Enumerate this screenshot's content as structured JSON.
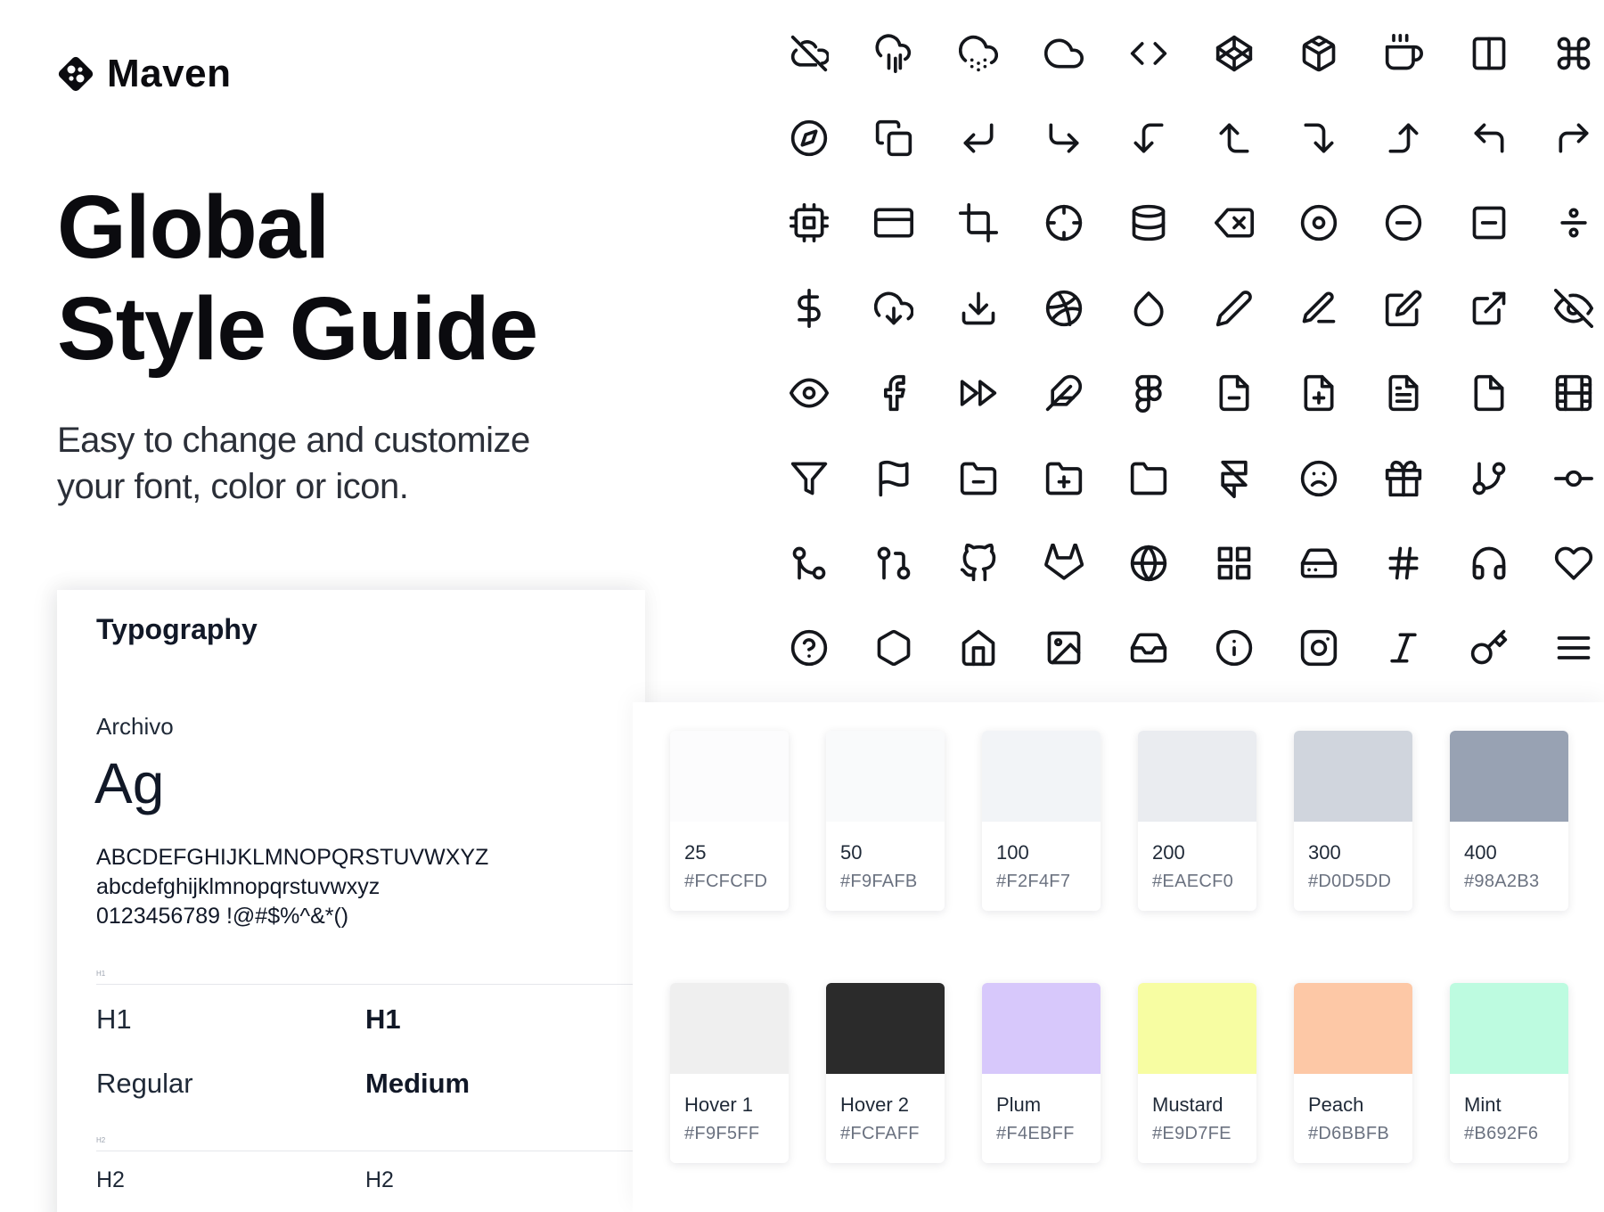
{
  "brand": {
    "name": "Maven",
    "logo_icon": "maven-logo-icon"
  },
  "hero": {
    "title_line1": "Global",
    "title_line2": "Style Guide",
    "subtitle_line1": "Easy to change and customize",
    "subtitle_line2": "your font, color or icon."
  },
  "typography": {
    "title": "Typography",
    "font_name": "Archivo",
    "sample": "Ag",
    "uppercase": "ABCDEFGHIJKLMNOPQRSTUVWXYZ",
    "lowercase": "abcdefghijklmnopqrstuvwxyz",
    "digits": "0123456789 !@#$%^&*()",
    "h1_label": "H1",
    "h2_label": "H2",
    "h1_regular": "H1",
    "h1_medium": "H1",
    "weight_regular": "Regular",
    "weight_medium": "Medium",
    "h2_regular": "H2",
    "h2_medium": "H2"
  },
  "icons": [
    "eye-off-cloud-icon",
    "cloud-rain-icon",
    "cloud-snow-icon",
    "cloud-icon",
    "code-icon",
    "codepen-icon",
    "codesandbox-icon",
    "coffee-icon",
    "columns-icon",
    "command-icon",
    "compass-icon",
    "copy-icon",
    "corner-down-left-icon",
    "corner-down-right-icon",
    "corner-left-down-icon",
    "corner-left-up-icon",
    "corner-right-down-icon",
    "corner-right-up-icon",
    "corner-up-left-icon",
    "corner-up-right-icon",
    "cpu-icon",
    "credit-card-icon",
    "crop-icon",
    "crosshair-icon",
    "database-icon",
    "delete-icon",
    "disc-icon",
    "minus-circle-icon",
    "minus-square-icon",
    "divide-icon",
    "dollar-sign-icon",
    "download-cloud-icon",
    "download-icon",
    "dribbble-icon",
    "droplet-icon",
    "pen-icon",
    "edit-2-icon",
    "edit-icon",
    "external-link-icon",
    "eye-off-icon",
    "eye-icon",
    "facebook-icon",
    "fast-forward-icon",
    "feather-icon",
    "figma-icon",
    "file-minus-icon",
    "file-plus-icon",
    "file-text-icon",
    "file-icon",
    "film-icon",
    "filter-icon",
    "flag-icon",
    "folder-minus-icon",
    "folder-plus-icon",
    "folder-icon",
    "framer-icon",
    "frown-icon",
    "gift-icon",
    "git-branch-icon",
    "git-commit-icon",
    "git-merge-icon",
    "git-pull-request-icon",
    "github-icon",
    "gitlab-icon",
    "globe-icon",
    "grid-icon",
    "hard-drive-icon",
    "hash-icon",
    "headphones-icon",
    "heart-icon",
    "help-circle-icon",
    "hexagon-icon",
    "home-icon",
    "image-icon",
    "inbox-icon",
    "info-icon",
    "instagram-icon",
    "italic-icon",
    "key-icon",
    "menu-icon"
  ],
  "colors": {
    "neutral": [
      {
        "name": "25",
        "hex": "#FCFCFD",
        "swatch": "#FCFCFD"
      },
      {
        "name": "50",
        "hex": "#F9FAFB",
        "swatch": "#F9FAFB"
      },
      {
        "name": "100",
        "hex": "#F2F4F7",
        "swatch": "#F2F4F7"
      },
      {
        "name": "200",
        "hex": "#EAECF0",
        "swatch": "#EAECF0"
      },
      {
        "name": "300",
        "hex": "#D0D5DD",
        "swatch": "#D0D5DD"
      },
      {
        "name": "400",
        "hex": "#98A2B3",
        "swatch": "#98A2B3"
      }
    ],
    "accent": [
      {
        "name": "Hover 1",
        "hex": "#F9F5FF",
        "swatch": "#EFEFEF"
      },
      {
        "name": "Hover 2",
        "hex": "#FCFAFF",
        "swatch": "#2B2B2B"
      },
      {
        "name": "Plum",
        "hex": "#F4EBFF",
        "swatch": "#D7C8FB"
      },
      {
        "name": "Mustard",
        "hex": "#E9D7FE",
        "swatch": "#F7FDA2"
      },
      {
        "name": "Peach",
        "hex": "#D6BBFB",
        "swatch": "#FDC8A6"
      },
      {
        "name": "Mint",
        "hex": "#B692F6",
        "swatch": "#BDFBE0"
      }
    ]
  }
}
